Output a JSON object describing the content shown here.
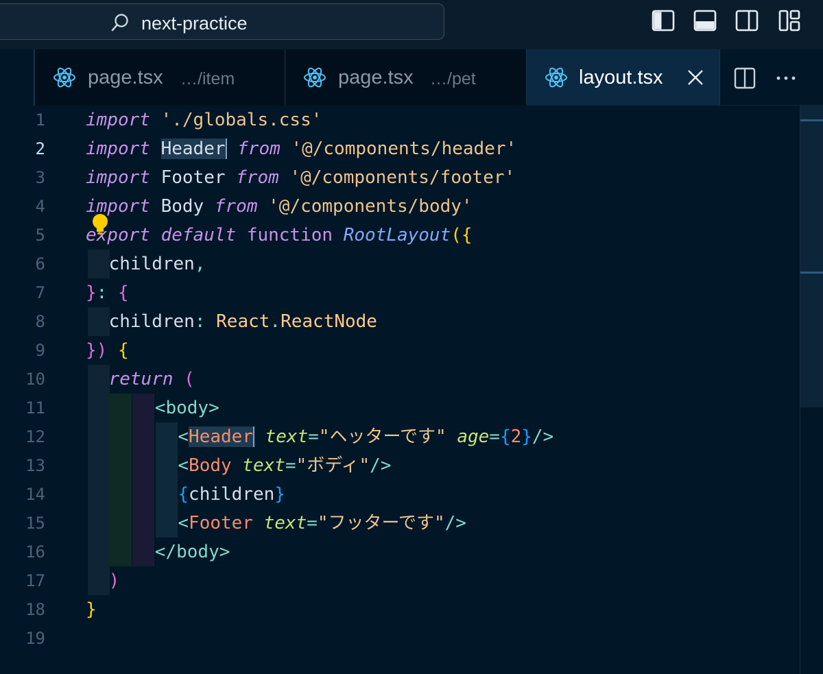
{
  "titlebar": {
    "search_text": "next-practice",
    "layout_icons": [
      "toggle-primary-sidebar-icon",
      "toggle-panel-icon",
      "toggle-secondary-sidebar-icon",
      "customize-layout-icon"
    ]
  },
  "tabs": [
    {
      "name": "page.tsx",
      "description": "…/item",
      "active": false,
      "icon": "react-icon"
    },
    {
      "name": "page.tsx",
      "description": "…/pet",
      "active": false,
      "icon": "react-icon"
    },
    {
      "name": "layout.tsx",
      "description": "",
      "active": true,
      "icon": "react-icon"
    }
  ],
  "tab_actions": [
    "split-editor-icon",
    "more-actions-icon"
  ],
  "editor": {
    "current_line": 2,
    "line_numbers": [
      "1",
      "2",
      "3",
      "4",
      "5",
      "6",
      "7",
      "8",
      "9",
      "10",
      "11",
      "12",
      "13",
      "14",
      "15",
      "16",
      "17",
      "18",
      "19"
    ],
    "tokens": {
      "l1": {
        "kw": "import",
        "str": "'./globals.css'"
      },
      "l2": {
        "kw": "import",
        "id": "Header",
        "from": "from",
        "str": "'@/components/header'"
      },
      "l3": {
        "kw": "import",
        "id": "Footer",
        "from": "from",
        "str": "'@/components/footer'"
      },
      "l4": {
        "kw": "import",
        "id": "Body",
        "from": "from",
        "str": "'@/components/body'"
      },
      "l5": {
        "export": "export",
        "default": "default",
        "function": "function",
        "name": "RootLayout",
        "open": "({"
      },
      "l6": {
        "id": "children",
        "pun": ","
      },
      "l7": {
        "close": "}",
        "colon": ":",
        "open": "{"
      },
      "l8": {
        "id": "children",
        "colon": ":",
        "ns": "React",
        "dot": ".",
        "type": "ReactNode"
      },
      "l9": {
        "close": "})",
        "open": "{"
      },
      "l10": {
        "ret": "return",
        "open": "("
      },
      "l11": {
        "text": "<body>"
      },
      "l12": {
        "lt": "<",
        "comp": "Header",
        "attr1": "text",
        "eq1": "=",
        "val1": "\"ヘッターです\"",
        "attr2": "age",
        "eq2": "=",
        "ob": "{",
        "num": "2",
        "cb": "}",
        "end": "/>"
      },
      "l13": {
        "lt": "<",
        "comp": "Body",
        "attr1": "text",
        "eq1": "=",
        "val1": "\"ボディ\"",
        "end": "/>"
      },
      "l14": {
        "ob": "{",
        "id": "children",
        "cb": "}"
      },
      "l15": {
        "lt": "<",
        "comp": "Footer",
        "attr1": "text",
        "eq1": "=",
        "val1": "\"フッターです\"",
        "end": "/>"
      },
      "l16": {
        "text": "</body>"
      },
      "l17": {
        "close": ")"
      },
      "l18": {
        "close": "}"
      }
    }
  },
  "colors": {
    "background": "#011627",
    "keyword": "#c792ea",
    "string": "#ecc48d",
    "function": "#82aaff",
    "tag": "#7fdbca",
    "component": "#f78c6c",
    "attribute": "#c5e478",
    "bracket_gold": "#ffd700",
    "bracket_orchid": "#da70d6",
    "bracket_blue": "#179fff"
  }
}
